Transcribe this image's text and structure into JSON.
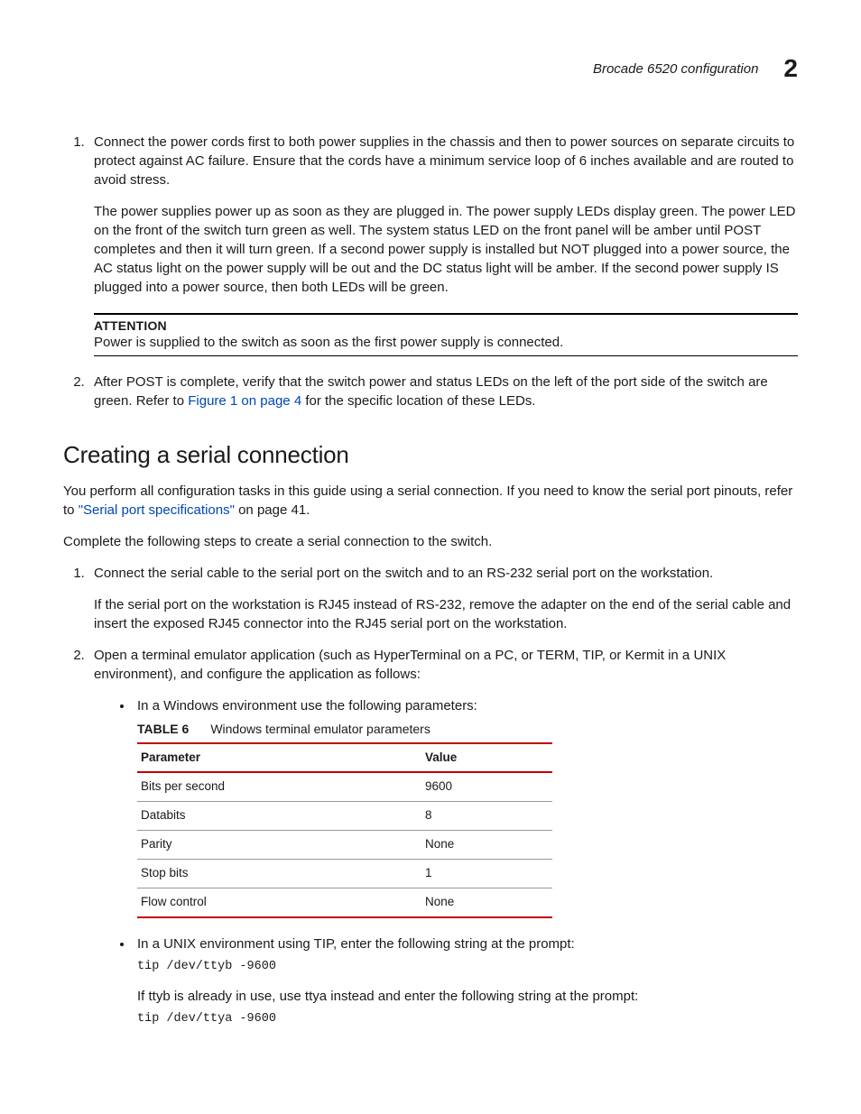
{
  "header": {
    "title": "Brocade 6520 configuration",
    "chapter_number": "2"
  },
  "steps_a": [
    {
      "paras": [
        "Connect the power cords first to both power supplies in the chassis and then to power sources on separate circuits to protect against AC failure. Ensure that the cords have a minimum service loop of 6 inches available and are routed to avoid stress.",
        "The power supplies power up as soon as they are plugged in. The power supply LEDs display green. The power LED on the front of the switch turn green as well. The system status LED on the front panel will be amber until POST completes and then it will turn green. If a second power supply is installed but NOT plugged into a power source, the AC status light on the power supply will be out and the DC status light will be amber. If the second power supply IS plugged into a power source, then both LEDs will be green."
      ]
    }
  ],
  "attention": {
    "label": "ATTENTION",
    "body": "Power is supplied to the switch as soon as the first power supply is connected."
  },
  "steps_a2": {
    "pre": "After POST is complete, verify that the switch power and status LEDs on the left of the port side of the switch are green. Refer to ",
    "link": "Figure 1 on page 4",
    "post": " for the specific location of these LEDs."
  },
  "section_heading": "Creating a serial connection",
  "intro": {
    "pre": "You perform all configuration tasks in this guide using a serial connection. If you need to know the serial port pinouts, refer to ",
    "link": "\"Serial port specifications\"",
    "post": " on page 41."
  },
  "intro2": "Complete the following steps to create a serial connection to the switch.",
  "steps_b": [
    {
      "paras": [
        "Connect the serial cable to the serial port on the switch and to an RS-232 serial port on the workstation.",
        "If the serial port on the workstation is RJ45 instead of RS-232, remove the adapter on the end of the serial cable and insert the exposed RJ45 connector into the RJ45 serial port on the workstation."
      ]
    },
    {
      "paras": [
        "Open a terminal emulator application (such as HyperTerminal on a PC, or TERM, TIP, or Kermit in a UNIX environment), and configure the application as follows:"
      ]
    }
  ],
  "bullet1": "In a Windows environment use the following parameters:",
  "table": {
    "label": "TABLE 6",
    "caption": "Windows terminal emulator parameters",
    "headers": [
      "Parameter",
      "Value"
    ],
    "rows": [
      [
        "Bits per second",
        "9600"
      ],
      [
        "Databits",
        "8"
      ],
      [
        "Parity",
        "None"
      ],
      [
        "Stop bits",
        "1"
      ],
      [
        "Flow control",
        "None"
      ]
    ]
  },
  "bullet2": {
    "text": "In a UNIX environment using TIP, enter the following string at the prompt:",
    "code1": "tip /dev/ttyb -9600",
    "note": "If ttyb is already in use, use ttya instead and enter the following string at the prompt:",
    "code2": "tip /dev/ttya -9600"
  }
}
